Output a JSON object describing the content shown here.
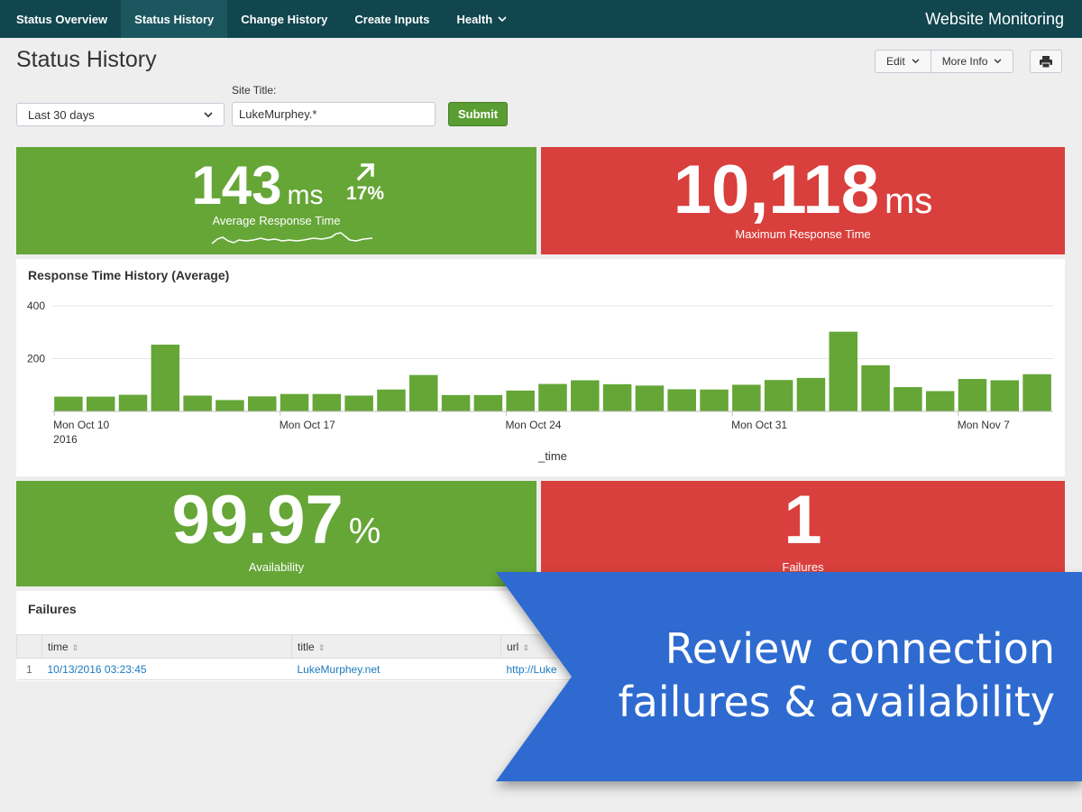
{
  "nav": {
    "items": [
      {
        "label": "Status Overview"
      },
      {
        "label": "Status History"
      },
      {
        "label": "Change History"
      },
      {
        "label": "Create Inputs"
      },
      {
        "label": "Health"
      }
    ],
    "app_title": "Website Monitoring"
  },
  "page": {
    "title": "Status History",
    "edit_label": "Edit",
    "more_info_label": "More Info",
    "print_icon": "print-icon"
  },
  "inputs": {
    "time_range": "Last 30 days",
    "site_title_label": "Site Title:",
    "site_title_value": "LukeMurphey.*",
    "submit_label": "Submit"
  },
  "avg_response": {
    "value": "143",
    "unit": "ms",
    "trend": "17%",
    "label": "Average Response Time"
  },
  "max_response": {
    "value": "10,118",
    "unit": "ms",
    "label": "Maximum Response Time"
  },
  "availability": {
    "value": "99.97",
    "unit": "%",
    "label": "Availability"
  },
  "failures_count": {
    "value": "1",
    "label": "Failures"
  },
  "chart_data": {
    "type": "bar",
    "title": "Response Time History (Average)",
    "xlabel": "_time",
    "ylabel": "",
    "ylim": [
      0,
      400
    ],
    "yticks": [
      200,
      400
    ],
    "xticks": [
      {
        "index": 0,
        "label": "Mon Oct 10",
        "sublabel": "2016"
      },
      {
        "index": 7,
        "label": "Mon Oct 17",
        "sublabel": ""
      },
      {
        "index": 14,
        "label": "Mon Oct 24",
        "sublabel": ""
      },
      {
        "index": 21,
        "label": "Mon Oct 31",
        "sublabel": ""
      },
      {
        "index": 28,
        "label": "Mon Nov 7",
        "sublabel": ""
      }
    ],
    "values": [
      56,
      56,
      63,
      253,
      60,
      43,
      57,
      66,
      66,
      60,
      83,
      138,
      62,
      62,
      79,
      104,
      118,
      103,
      98,
      84,
      83,
      101,
      119,
      127,
      302,
      175,
      92,
      77,
      123,
      118,
      141
    ],
    "color": "#65a637"
  },
  "failures_table": {
    "title": "Failures",
    "columns": [
      "time",
      "title",
      "url"
    ],
    "rows": [
      {
        "num": "1",
        "time": "10/13/2016 03:23:45",
        "title": "LukeMurphey.net",
        "url": "http://Luke"
      }
    ]
  },
  "banner": {
    "line1": "Review connection",
    "line2": "failures & availability",
    "color": "#2d6ad0"
  }
}
